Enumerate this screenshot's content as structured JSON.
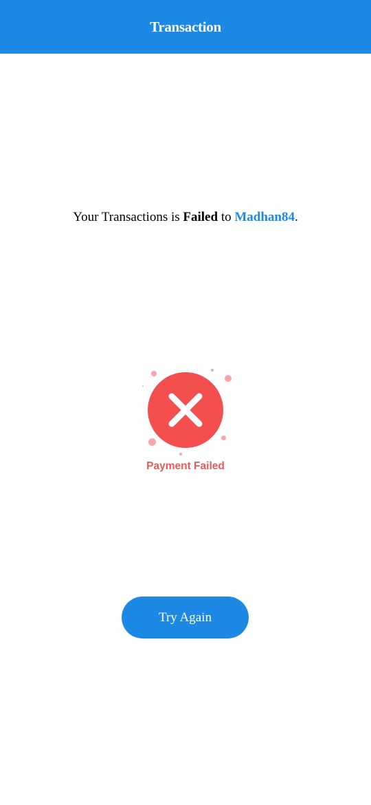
{
  "header": {
    "title": "Transaction"
  },
  "message": {
    "prefix": "Your Transactions is ",
    "status": "Failed",
    "connector": " to ",
    "recipient": "Madhan84",
    "suffix": "."
  },
  "result": {
    "icon": "close-icon",
    "caption": "Payment Failed"
  },
  "actions": {
    "retry_label": "Try Again"
  },
  "colors": {
    "primary": "#1e88e5",
    "error": "#f44f4f",
    "error_text": "#e85a5a"
  }
}
